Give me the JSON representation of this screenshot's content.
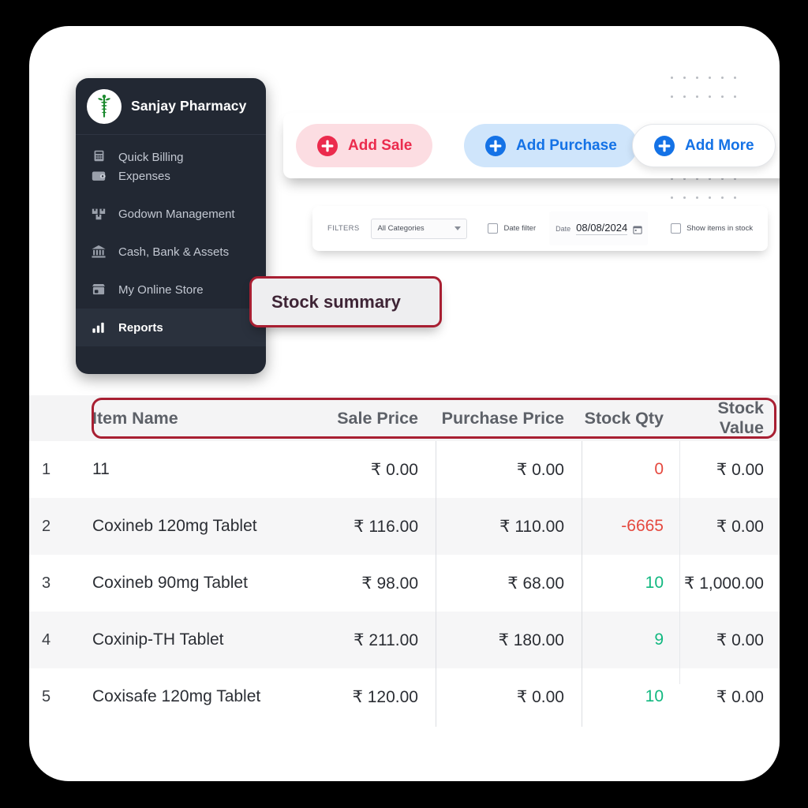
{
  "brand": {
    "name": "Sanjay Pharmacy",
    "logo_icon": "caduceus-icon",
    "logo_color": "#1c8a2e"
  },
  "sidebar": {
    "items": [
      {
        "label": "Quick Billing",
        "icon": "calculator-icon",
        "active": false,
        "clipped": true
      },
      {
        "label": "Expenses",
        "icon": "wallet-icon",
        "active": false,
        "clipped": false
      },
      {
        "label": "Godown Management",
        "icon": "boxes-icon",
        "active": false,
        "clipped": false
      },
      {
        "label": "Cash, Bank & Assets",
        "icon": "bank-icon",
        "active": false,
        "clipped": false
      },
      {
        "label": "My Online Store",
        "icon": "store-icon",
        "active": false,
        "clipped": false
      },
      {
        "label": "Reports",
        "icon": "bar-chart-icon",
        "active": true,
        "clipped": false
      }
    ]
  },
  "actions": {
    "add_sale": {
      "label": "Add Sale",
      "icon": "plus-circle-icon",
      "color": "#eb2b4d",
      "bg": "#fcdde2"
    },
    "add_purchase": {
      "label": "Add Purchase",
      "icon": "plus-circle-icon",
      "color": "#1472e6",
      "bg": "#cfe5fb"
    },
    "add_more": {
      "label": "Add More",
      "icon": "plus-circle-icon",
      "color": "#1472e6",
      "bg": "#ffffff"
    }
  },
  "filters": {
    "label": "FILTERS",
    "category": {
      "selected": "All Categories",
      "icon": "chevron-down-icon"
    },
    "date_filter": {
      "label": "Date filter",
      "checked": false
    },
    "date": {
      "prefix": "Date",
      "value": "08/08/2024",
      "icon": "calendar-icon"
    },
    "show_in_stock": {
      "label": "Show items in stock",
      "checked": false
    }
  },
  "callout": {
    "stock_summary": "Stock summary",
    "border_color": "#a81f32",
    "text_color": "#3e2435"
  },
  "table": {
    "columns": [
      "Item Name",
      "Sale Price",
      "Purchase Price",
      "Stock Qty",
      "Stock Value"
    ],
    "rows": [
      {
        "index": "1",
        "name": "11",
        "sale_price": "₹ 0.00",
        "purchase_price": "₹ 0.00",
        "stock_qty": "0",
        "qty_sign": "neg",
        "stock_value": "₹ 0.00"
      },
      {
        "index": "2",
        "name": "Coxineb 120mg Tablet",
        "sale_price": "₹ 116.00",
        "purchase_price": "₹ 110.00",
        "stock_qty": "-6665",
        "qty_sign": "neg",
        "stock_value": "₹ 0.00"
      },
      {
        "index": "3",
        "name": "Coxineb 90mg Tablet",
        "sale_price": "₹ 98.00",
        "purchase_price": "₹ 68.00",
        "stock_qty": "10",
        "qty_sign": "pos",
        "stock_value": "₹ 1,000.00"
      },
      {
        "index": "4",
        "name": "Coxinip-TH Tablet",
        "sale_price": "₹ 211.00",
        "purchase_price": "₹ 180.00",
        "stock_qty": "9",
        "qty_sign": "pos",
        "stock_value": "₹ 0.00"
      },
      {
        "index": "5",
        "name": "Coxisafe 120mg Tablet",
        "sale_price": "₹ 120.00",
        "purchase_price": "₹ 0.00",
        "stock_qty": "10",
        "qty_sign": "pos",
        "stock_value": "₹ 0.00"
      }
    ]
  },
  "colors": {
    "qty_negative": "#e5493f",
    "qty_positive": "#12b880",
    "sidebar_bg": "#222833",
    "page_bg": "#000000"
  }
}
